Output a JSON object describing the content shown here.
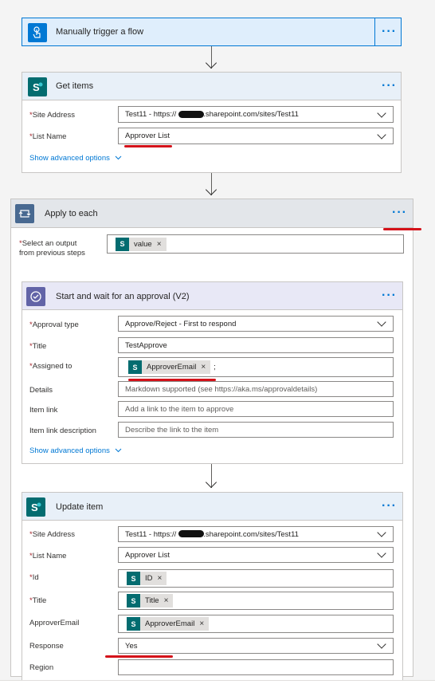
{
  "trigger": {
    "title": "Manually trigger a flow",
    "icon": "touch-icon"
  },
  "get_items": {
    "title": "Get items",
    "icon": "sharepoint-icon",
    "fields": [
      {
        "label": "Site Address",
        "required": true,
        "value": "Test11 - https://",
        "value_suffix": ".sharepoint.com/sites/Test11"
      },
      {
        "label": "List Name",
        "required": true,
        "value": "Approver List"
      }
    ],
    "advanced": "Show advanced options"
  },
  "apply_each": {
    "title": "Apply to each",
    "icon": "loop-icon",
    "select_label_line1": "Select an output",
    "select_label_line2": "from previous steps",
    "token": "value"
  },
  "approval": {
    "title": "Start and wait for an approval (V2)",
    "icon": "approval-icon",
    "fields": [
      {
        "label": "Approval type",
        "required": true,
        "value": "Approve/Reject - First to respond"
      },
      {
        "label": "Title",
        "required": true,
        "value": "TestApprove"
      },
      {
        "label": "Assigned to",
        "required": true,
        "token": "ApproverEmail",
        "suffix": ";"
      },
      {
        "label": "Details",
        "required": false,
        "placeholder": "Markdown supported (see https://aka.ms/approvaldetails)"
      },
      {
        "label": "Item link",
        "required": false,
        "placeholder": "Add a link to the item to approve"
      },
      {
        "label": "Item link description",
        "required": false,
        "placeholder": "Describe the link to the item"
      }
    ],
    "advanced": "Show advanced options"
  },
  "update_item": {
    "title": "Update item",
    "icon": "sharepoint-icon",
    "fields": [
      {
        "label": "Site Address",
        "required": true,
        "value": "Test11 - https://",
        "value_suffix": ".sharepoint.com/sites/Test11"
      },
      {
        "label": "List Name",
        "required": true,
        "value": "Approver List"
      },
      {
        "label": "Id",
        "required": true,
        "token": "ID"
      },
      {
        "label": "Title",
        "required": true,
        "token": "Title"
      },
      {
        "label": "ApproverEmail",
        "required": false,
        "token": "ApproverEmail"
      },
      {
        "label": "Response",
        "required": false,
        "value": "Yes"
      },
      {
        "label": "Region",
        "required": false,
        "value": ""
      }
    ]
  },
  "colors": {
    "accent": "#0078d4",
    "sharepoint": "#036c70",
    "approval": "#6264a7",
    "annotation": "#d4121a"
  },
  "menu_glyph": "···",
  "token_remove": "×"
}
